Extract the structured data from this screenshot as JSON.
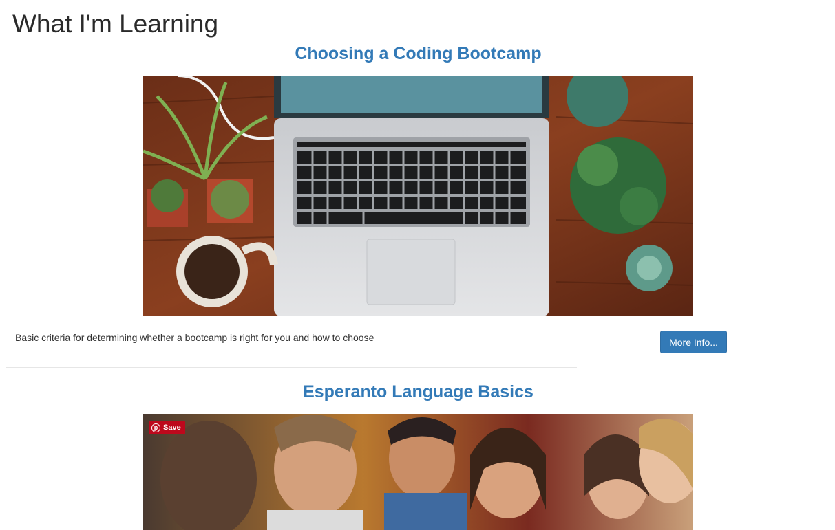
{
  "page": {
    "title": "What I'm Learning"
  },
  "cards": [
    {
      "title": "Choosing a Coding Bootcamp",
      "image_alt": "laptop-on-wooden-desk-with-plants-and-coffee",
      "description": "Basic criteria for determining whether a bootcamp is right for you and how to choose",
      "button_label": "More Info..."
    },
    {
      "title": "Esperanto Language Basics",
      "image_alt": "group-of-friends-laughing",
      "pin_save_label": "Save"
    }
  ],
  "colors": {
    "link_blue": "#337ab7",
    "pinterest_red": "#bd081c"
  }
}
